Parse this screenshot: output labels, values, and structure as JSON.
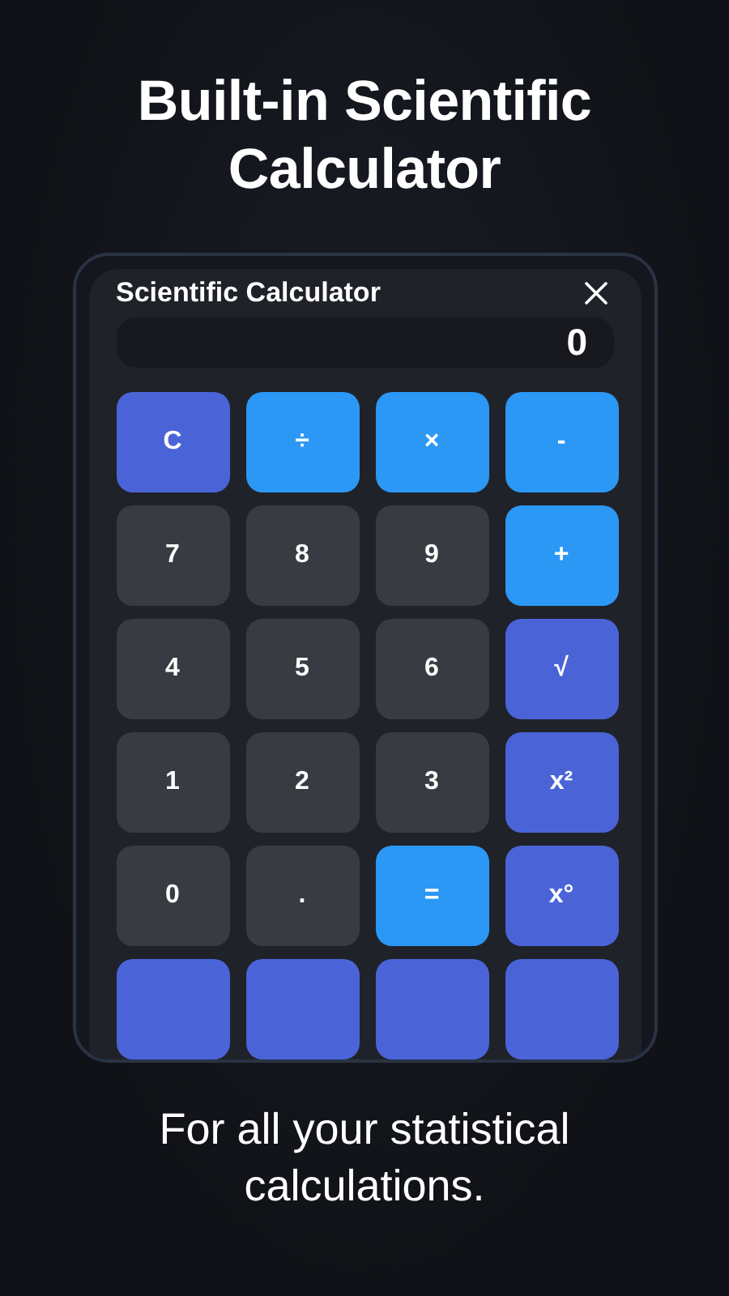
{
  "headline": "Built-in Scientific Calculator",
  "dialog": {
    "title": "Scientific Calculator",
    "display": "0",
    "keys": [
      {
        "label": "C",
        "kind": "clear"
      },
      {
        "label": "÷",
        "kind": "op"
      },
      {
        "label": "×",
        "kind": "op"
      },
      {
        "label": "-",
        "kind": "op"
      },
      {
        "label": "7",
        "kind": "num"
      },
      {
        "label": "8",
        "kind": "num"
      },
      {
        "label": "9",
        "kind": "num"
      },
      {
        "label": "+",
        "kind": "op"
      },
      {
        "label": "4",
        "kind": "num"
      },
      {
        "label": "5",
        "kind": "num"
      },
      {
        "label": "6",
        "kind": "num"
      },
      {
        "label": "√",
        "kind": "fn"
      },
      {
        "label": "1",
        "kind": "num"
      },
      {
        "label": "2",
        "kind": "num"
      },
      {
        "label": "3",
        "kind": "num"
      },
      {
        "label": "x²",
        "kind": "fn"
      },
      {
        "label": "0",
        "kind": "num"
      },
      {
        "label": ".",
        "kind": "num"
      },
      {
        "label": "=",
        "kind": "op"
      },
      {
        "label": "x°",
        "kind": "fn"
      },
      {
        "kind": "fn"
      },
      {
        "kind": "fn"
      },
      {
        "kind": "fn"
      },
      {
        "kind": "fn"
      }
    ]
  },
  "caption": "For all your statistical calculations."
}
